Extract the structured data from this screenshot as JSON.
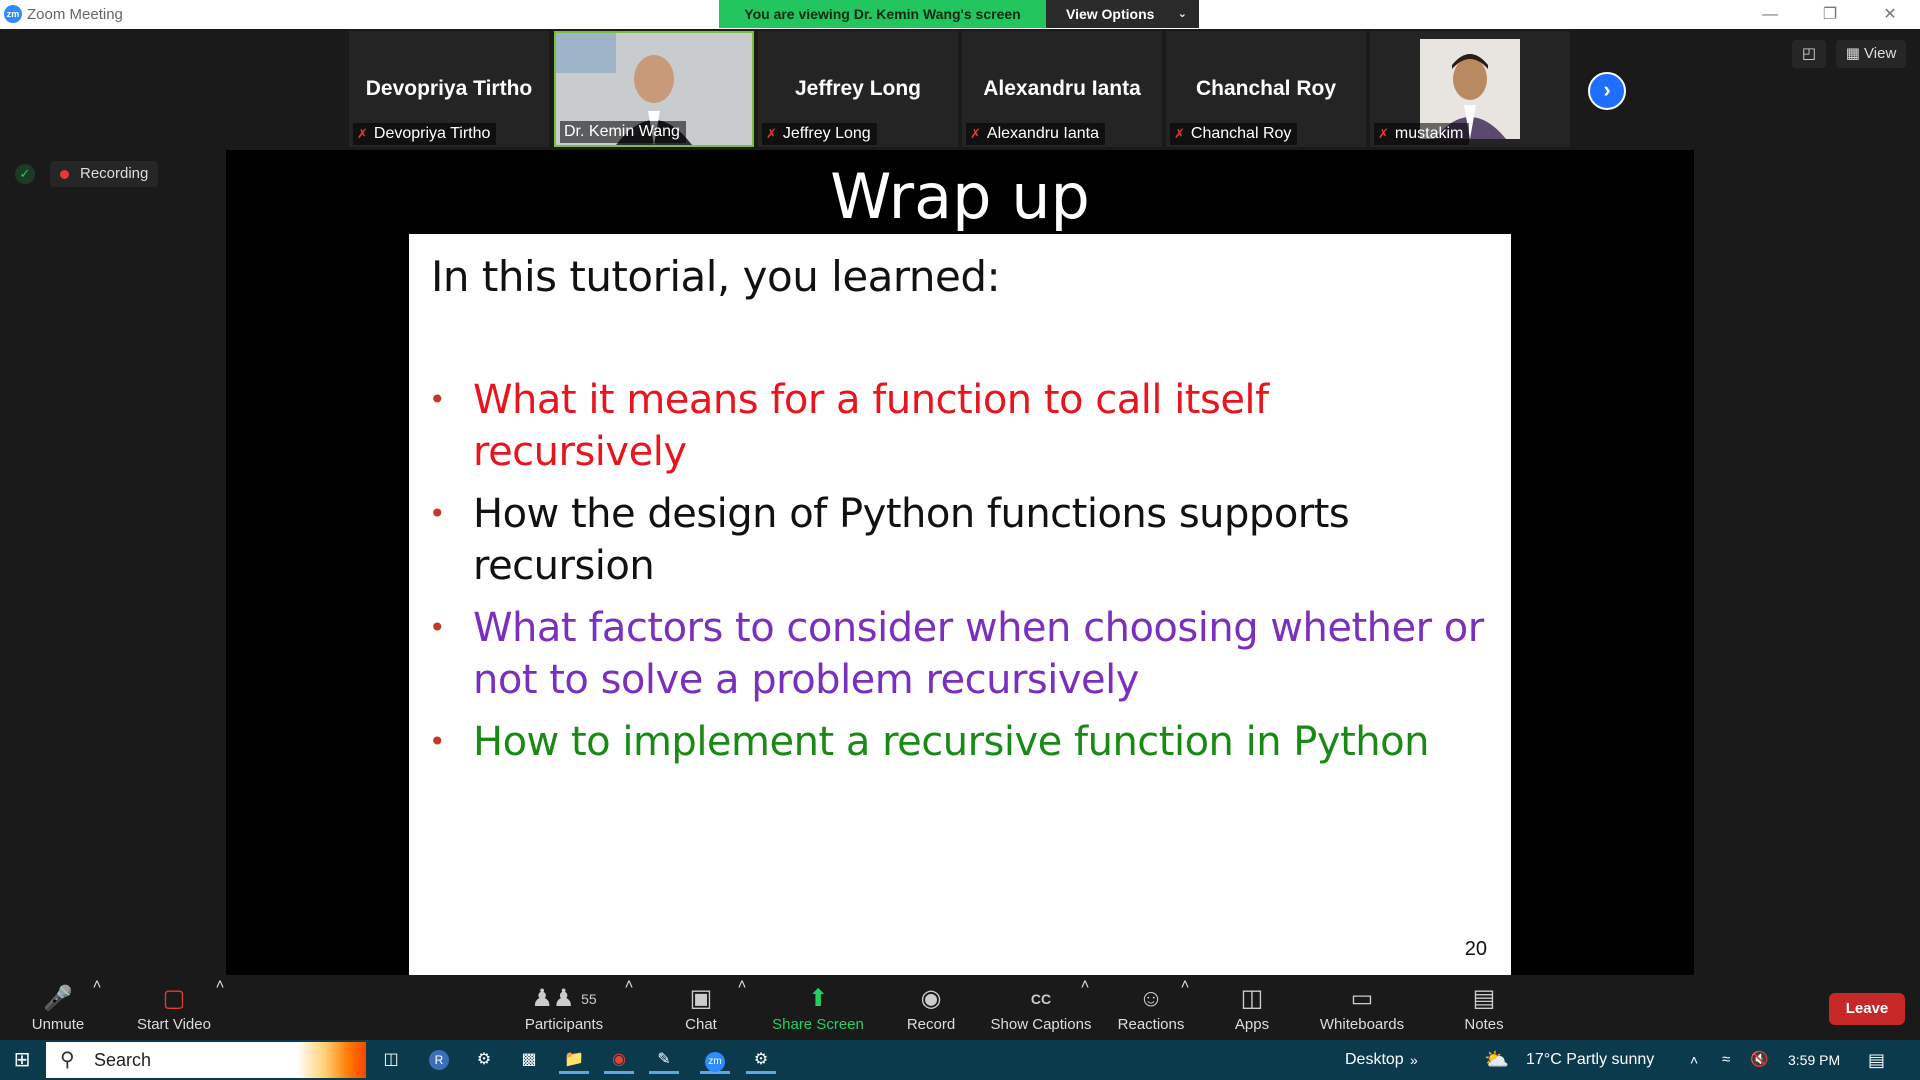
{
  "window": {
    "title": "Zoom Meeting",
    "logo_text": "zm",
    "banner": "You are viewing Dr. Kemin Wang's screen",
    "view_options": "View Options"
  },
  "gallery": {
    "tiles": [
      {
        "big_name": "Devopriya Tirtho",
        "label": "Devopriya Tirtho"
      },
      {
        "big_name": "",
        "label": "Dr. Kemin Wang"
      },
      {
        "big_name": "Jeffrey Long",
        "label": "Jeffrey Long"
      },
      {
        "big_name": "Alexandru Ianta",
        "label": "Alexandru Ianta"
      },
      {
        "big_name": "Chanchal Roy",
        "label": "Chanchal Roy"
      },
      {
        "big_name": "",
        "label": "mustakim"
      }
    ],
    "view_label": "View"
  },
  "status": {
    "recording": "Recording"
  },
  "slide": {
    "title": "Wrap up",
    "intro": "In this tutorial, you learned:",
    "bullets": [
      {
        "text": "What it means for a function to call itself recursively",
        "color": "#e8141e"
      },
      {
        "text": "How the design of Python functions supports recursion",
        "color": "#111111"
      },
      {
        "text": "What factors to consider when choosing whether or not to solve a problem recursively",
        "color": "#7b2fbe"
      },
      {
        "text": "How to implement a recursive function in Python",
        "color": "#1a8a17"
      }
    ],
    "page_number": "20"
  },
  "controls": {
    "unmute": "Unmute",
    "start_video": "Start Video",
    "participants": "Participants",
    "participants_count": "55",
    "chat": "Chat",
    "share_screen": "Share Screen",
    "record": "Record",
    "show_captions": "Show Captions",
    "captions_icon": "CC",
    "reactions": "Reactions",
    "apps": "Apps",
    "whiteboards": "Whiteboards",
    "notes": "Notes",
    "leave": "Leave"
  },
  "taskbar": {
    "search": "Search",
    "desktop": "Desktop",
    "weather": "17°C  Partly sunny",
    "time": "3:59 PM",
    "zoom_icon_text": "zm",
    "r_icon_text": "R"
  }
}
